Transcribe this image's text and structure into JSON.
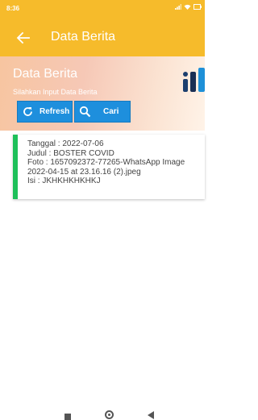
{
  "status_bar": {
    "time": "8:36"
  },
  "app_bar": {
    "title": "Data Berita"
  },
  "hero": {
    "title": "Data Berita",
    "subtitle": "Silahkan Input Data Berita"
  },
  "buttons": {
    "refresh_label": "Refresh",
    "search_label": "Cari"
  },
  "news_items": [
    {
      "tanggal": "Tanggal : 2022-07-06",
      "judul": "Judul : BOSTER COVID",
      "foto": "Foto : 1657092372-77265-WhatsApp Image 2022-04-15 at 23.16.16 (2).jpeg",
      "isi": "Isi : JKHKHKHKHKJ"
    }
  ],
  "colors": {
    "app_bar": "#f6bb2b",
    "button": "#1e8fdd",
    "card_accent": "#1ec05a"
  },
  "icons": {
    "back": "arrow-left",
    "refresh": "refresh",
    "search": "magnifier"
  }
}
